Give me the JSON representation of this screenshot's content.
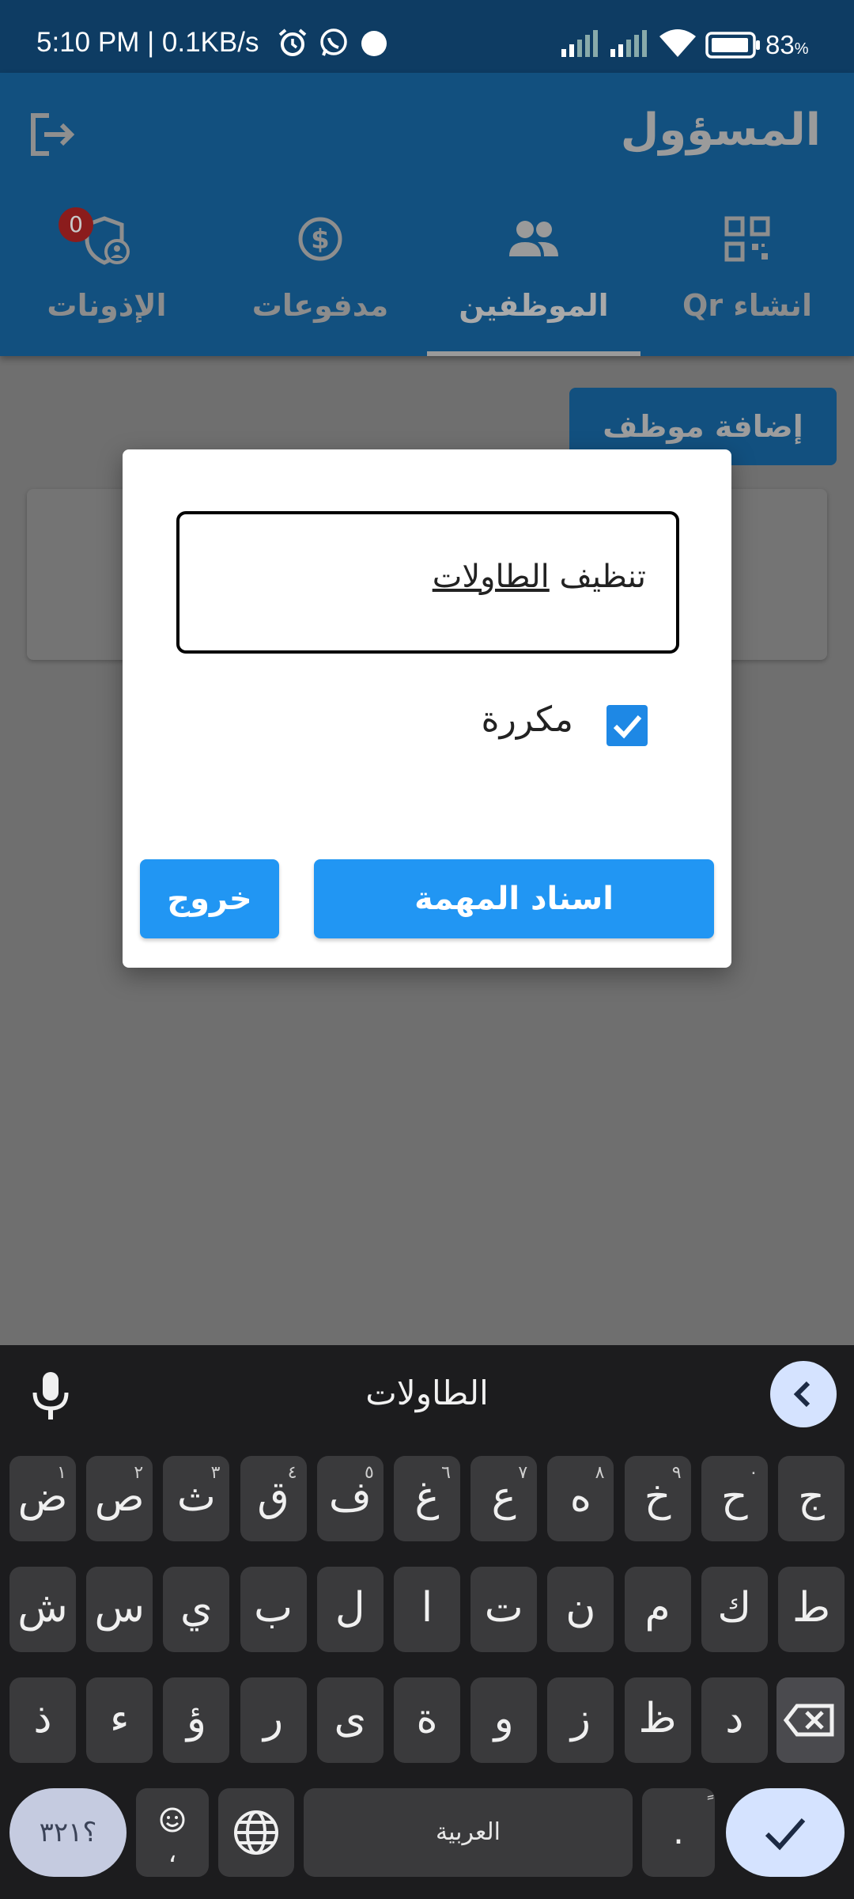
{
  "status_bar": {
    "text": "5:10 PM | 0.1KB/s",
    "battery": "83",
    "battery_unit": "%"
  },
  "app_bar": {
    "title": "المسؤول",
    "tabs": [
      {
        "label": "انشاء Qr",
        "icon": "qr-code-icon"
      },
      {
        "label": "الموظفين",
        "icon": "people-icon",
        "active": true
      },
      {
        "label": "مدفوعات",
        "icon": "dollar-icon"
      },
      {
        "label": "الإذونات",
        "icon": "permission-user-icon",
        "badge": "0"
      }
    ]
  },
  "content": {
    "add_employee_label": "إضافة موظف"
  },
  "dialog": {
    "task_value_part1": "تنظيف",
    "task_value_part2": "الطاولات",
    "repeat_label": "مكررة",
    "repeat_checked": true,
    "assign_label": "اسناد المهمة",
    "exit_label": "خروج"
  },
  "keyboard": {
    "suggestion": "الطاولات",
    "row1": [
      {
        "ch": "ض",
        "hint": "١"
      },
      {
        "ch": "ص",
        "hint": "٢"
      },
      {
        "ch": "ث",
        "hint": "٣"
      },
      {
        "ch": "ق",
        "hint": "٤"
      },
      {
        "ch": "ف",
        "hint": "٥"
      },
      {
        "ch": "غ",
        "hint": "٦"
      },
      {
        "ch": "ع",
        "hint": "٧"
      },
      {
        "ch": "ه",
        "hint": "٨"
      },
      {
        "ch": "خ",
        "hint": "٩"
      },
      {
        "ch": "ح",
        "hint": "٠"
      },
      {
        "ch": "ج",
        "hint": ""
      }
    ],
    "row2": [
      "ش",
      "س",
      "ي",
      "ب",
      "ل",
      "ا",
      "ت",
      "ن",
      "م",
      "ك",
      "ط"
    ],
    "row3": [
      "ذ",
      "ء",
      "ؤ",
      "ر",
      "ى",
      "ة",
      "و",
      "ز",
      "ظ",
      "د"
    ],
    "num_label": "؟٣٢١",
    "emoji_sub": "،",
    "space_label": "العربية",
    "dot_label": ".",
    "dot_hint": "ً"
  },
  "colors": {
    "status_bar": "#0e3c63",
    "app_bar": "#12507f",
    "primary_button": "#2196f3",
    "checkbox": "#1e88e5",
    "badge": "#8b1c1c",
    "keyboard_bg": "#1c1c1e",
    "keyboard_accent": "#d5e3ff"
  }
}
